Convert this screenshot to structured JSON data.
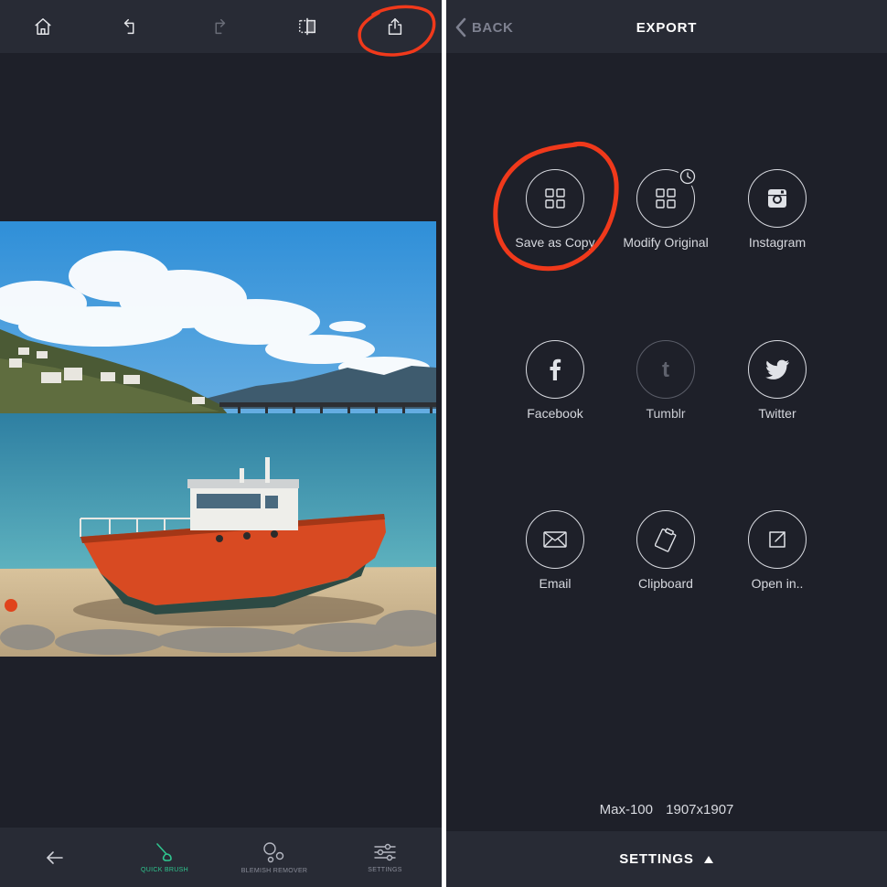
{
  "left_panel": {
    "toolbar": {
      "home_icon": "home-icon",
      "undo_icon": "undo-icon",
      "redo_icon": "redo-icon",
      "compare_icon": "compare-icon",
      "share_icon": "share-icon"
    },
    "bottom_bar": {
      "back_icon": "arrow-left-icon",
      "items": [
        {
          "label": "QUICK BRUSH",
          "icon": "brush-icon",
          "active": true
        },
        {
          "label": "BLEMISH REMOVER",
          "icon": "blemish-icon",
          "active": false
        },
        {
          "label": "SETTINGS",
          "icon": "sliders-icon",
          "active": false
        }
      ]
    }
  },
  "right_panel": {
    "header": {
      "back_label": "BACK",
      "title": "EXPORT"
    },
    "share_options": [
      {
        "label": "Save as Copy",
        "icon": "grid-icon"
      },
      {
        "label": "Modify Original",
        "icon": "grid-icon"
      },
      {
        "label": "Instagram",
        "icon": "instagram-icon"
      },
      {
        "label": "Facebook",
        "icon": "facebook-icon"
      },
      {
        "label": "Tumblr",
        "icon": "tumblr-icon"
      },
      {
        "label": "Twitter",
        "icon": "twitter-icon"
      },
      {
        "label": "Email",
        "icon": "envelope-icon"
      },
      {
        "label": "Clipboard",
        "icon": "clipboard-icon"
      },
      {
        "label": "Open in..",
        "icon": "open-in-icon"
      }
    ],
    "quality": "Max-100",
    "dimensions": "1907x1907",
    "settings_label": "SETTINGS"
  },
  "colors": {
    "background": "#1e2029",
    "bar": "#282b35",
    "accent_active": "#2fc48e",
    "annotation": "#f0391b"
  }
}
